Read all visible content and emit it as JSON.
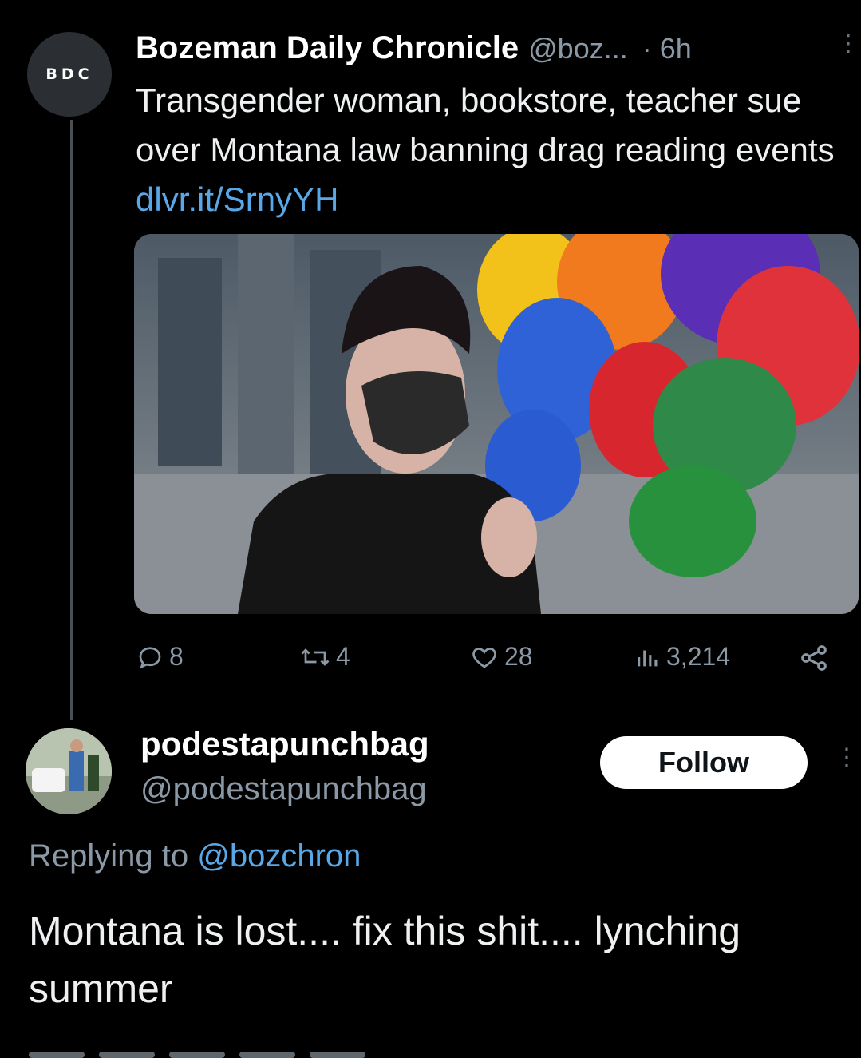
{
  "tweet": {
    "avatar_text": "BDC",
    "author_name": "Bozeman Daily Chronicle",
    "author_handle": "@boz...",
    "time": "· 6h",
    "text": "Transgender woman, bookstore, teacher sue over Montana law banning drag reading events",
    "link": "dlvr.it/SrnyYH",
    "actions": {
      "replies": "8",
      "reposts": "4",
      "likes": "28",
      "views": "3,214"
    }
  },
  "reply": {
    "name": "podestapunchbag",
    "handle": "@podestapunchbag",
    "follow_label": "Follow",
    "replying_prefix": "Replying to",
    "replying_to": "@bozchron",
    "text": "Montana is lost.... fix this shit.... lynching summer"
  },
  "icons": {
    "reply": "comment-icon",
    "repost": "repost-icon",
    "like": "heart-icon",
    "views": "analytics-icon",
    "share": "share-icon",
    "more": "more-vertical-icon"
  },
  "colors": {
    "background": "#000000",
    "link": "#5aa7e8",
    "secondary_text": "#8b98a5"
  }
}
